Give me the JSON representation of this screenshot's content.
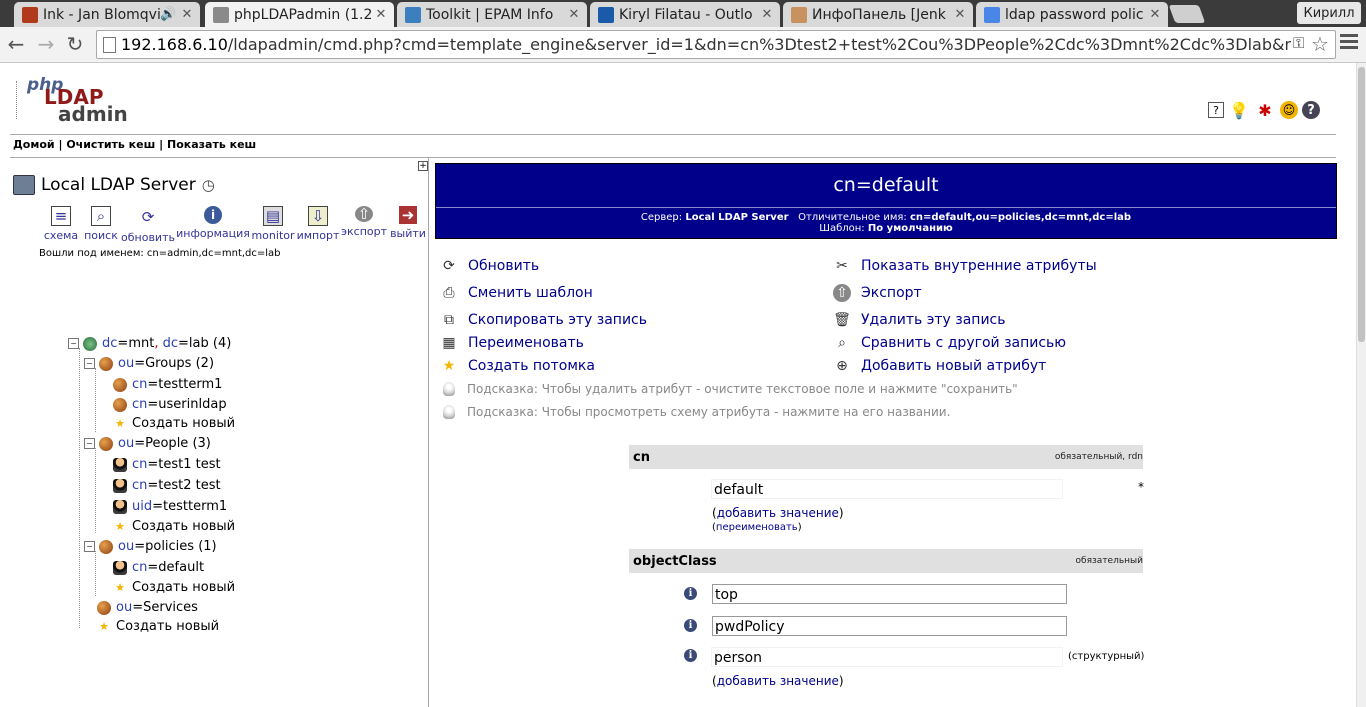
{
  "browser": {
    "tabs": [
      {
        "title": "Ink - Jan Blomqvi",
        "close": "✕",
        "active": false,
        "favicon_color": "#b23a1c"
      },
      {
        "title": "phpLDAPadmin (1.2",
        "close": "✕",
        "active": true,
        "favicon_color": "#8a8a8a"
      },
      {
        "title": "Toolkit | EPAM Info",
        "close": "✕",
        "active": false,
        "favicon_color": "#3b7fbf"
      },
      {
        "title": "Kiryl Filatau - Outlo",
        "close": "✕",
        "active": false,
        "favicon_color": "#1a5aa8"
      },
      {
        "title": "ИнфоПанель [Jenk",
        "close": "✕",
        "active": false,
        "favicon_color": "#c7925e"
      },
      {
        "title": "ldap password polic",
        "close": "✕",
        "active": false,
        "favicon_color": "#4a86e8"
      }
    ],
    "user_button": "Кирилл",
    "url_host": "192.168.6.10",
    "url_rest": "/ldapadmin/cmd.php?cmd=template_engine&server_id=1&dn=cn%3Dtest2+test%2Cou%3DPeople%2Cdc%3Dmnt%2Cdc%3Dlab&modified_attrs[]=use"
  },
  "header": {
    "logo_php": "php",
    "logo_ldap": "LDAP",
    "logo_admin": "admin",
    "breadcrumb": [
      "Домой",
      "Очистить кеш",
      "Показать кеш"
    ],
    "breadcrumb_sep": " | "
  },
  "tree": {
    "server_name": "Local LDAP Server",
    "tools": [
      {
        "label": "схема",
        "icon": "schema-icon"
      },
      {
        "label": "поиск",
        "icon": "search-icon"
      },
      {
        "label": "обновить",
        "icon": "refresh-icon"
      },
      {
        "label": "информация",
        "icon": "info-icon"
      },
      {
        "label": "monitor",
        "icon": "monitor-icon"
      },
      {
        "label": "импорт",
        "icon": "import-icon"
      },
      {
        "label": "экспорт",
        "icon": "export-icon"
      },
      {
        "label": "выйти",
        "icon": "logout-icon"
      }
    ],
    "logged_in": "Вошли под именем: cn=admin,dc=mnt,dc=lab",
    "root": {
      "attr1": "dc",
      "val1": "mnt",
      "attr2": "dc",
      "val2": "lab",
      "count": "(4)"
    },
    "groups": {
      "attr": "ou",
      "val": "Groups",
      "count": "(2)",
      "items": [
        "testterm1",
        "userinldap"
      ],
      "create": "Создать новый"
    },
    "people": {
      "attr": "ou",
      "val": "People",
      "count": "(3)",
      "items": [
        {
          "a": "cn",
          "v": "test1 test"
        },
        {
          "a": "cn",
          "v": "test2 test"
        },
        {
          "a": "uid",
          "v": "testterm1"
        }
      ],
      "create": "Создать новый"
    },
    "policies": {
      "attr": "ou",
      "val": "policies",
      "count": "(1)",
      "items": [
        {
          "a": "cn",
          "v": "default"
        }
      ],
      "create": "Создать новый"
    },
    "services": {
      "attr": "ou",
      "val": "Services"
    },
    "root_create": "Создать новый"
  },
  "entry": {
    "title": "cn=default",
    "server_label": "Сервер:",
    "server_value": "Local LDAP Server",
    "dn_label": "Отличительное имя:",
    "dn_value": "cn=default,ou=policies,dc=mnt,dc=lab",
    "template_label": "Шаблон:",
    "template_value": "По умолчанию",
    "actions_left": [
      "Обновить",
      "Сменить шаблон",
      "Скопировать эту запись",
      "Переименовать",
      "Создать потомка"
    ],
    "actions_right": [
      "Показать внутренние атрибуты",
      "Экспорт",
      "Удалить эту запись",
      "Сравнить с другой записью",
      "Добавить новый атрибут"
    ],
    "hints": [
      "Подсказка: Чтобы удалить атрибут - очистите текстовое поле и нажмите \"сохранить\"",
      "Подсказка: Чтобы просмотреть схему атрибута - нажмите на его названии."
    ],
    "attrs": {
      "cn": {
        "name": "cn",
        "flags": "обязательный, rdn",
        "value": "default",
        "marker": "*",
        "add_value": "добавить значение",
        "rename": "переименовать"
      },
      "objectClass": {
        "name": "objectClass",
        "flags": "обязательный",
        "values": [
          "top",
          "pwdPolicy",
          "person"
        ],
        "structural": "(структурный)",
        "add_value": "добавить значение"
      }
    }
  }
}
